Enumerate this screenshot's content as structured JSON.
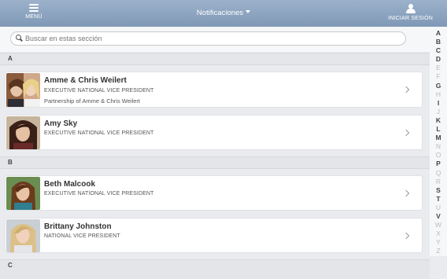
{
  "header": {
    "menu_label": "MENÚ",
    "title": "Notificaciones",
    "login_label": "INICIAR SESIÓN"
  },
  "search": {
    "placeholder": "Buscar en estas sección"
  },
  "sections": {
    "a": "A",
    "b": "B",
    "c": "C"
  },
  "contacts": [
    {
      "name": "Amme & Chris Weilert",
      "title": "EXECUTIVE NATIONAL VICE PRESIDENT",
      "subtitle": "Partnership of Amme & Chris Weilert"
    },
    {
      "name": "Amy Sky",
      "title": "EXECUTIVE NATIONAL VICE PRESIDENT"
    },
    {
      "name": "Beth Malcook",
      "title": "EXECUTIVE NATIONAL VICE PRESIDENT"
    },
    {
      "name": "Brittany Johnston",
      "title": "NATIONAL VICE PRESIDENT"
    }
  ],
  "alphabet": [
    {
      "letter": "A",
      "active": true
    },
    {
      "letter": "B",
      "active": true
    },
    {
      "letter": "C",
      "active": true
    },
    {
      "letter": "D",
      "active": true
    },
    {
      "letter": "E",
      "active": false
    },
    {
      "letter": "F",
      "active": false
    },
    {
      "letter": "G",
      "active": true
    },
    {
      "letter": "H",
      "active": false
    },
    {
      "letter": "I",
      "active": true
    },
    {
      "letter": "J",
      "active": false
    },
    {
      "letter": "K",
      "active": true
    },
    {
      "letter": "L",
      "active": true
    },
    {
      "letter": "M",
      "active": true
    },
    {
      "letter": "N",
      "active": false
    },
    {
      "letter": "O",
      "active": false
    },
    {
      "letter": "P",
      "active": true
    },
    {
      "letter": "Q",
      "active": false
    },
    {
      "letter": "R",
      "active": false
    },
    {
      "letter": "S",
      "active": true
    },
    {
      "letter": "T",
      "active": true
    },
    {
      "letter": "U",
      "active": false
    },
    {
      "letter": "V",
      "active": true
    },
    {
      "letter": "W",
      "active": false
    },
    {
      "letter": "X",
      "active": false
    },
    {
      "letter": "Y",
      "active": false
    },
    {
      "letter": "Z",
      "active": false
    }
  ],
  "colors": {
    "header_top": "#9cb2cb",
    "header_bottom": "#7f98b6",
    "index_active": "#444444",
    "index_inactive": "#bbbbbb"
  }
}
